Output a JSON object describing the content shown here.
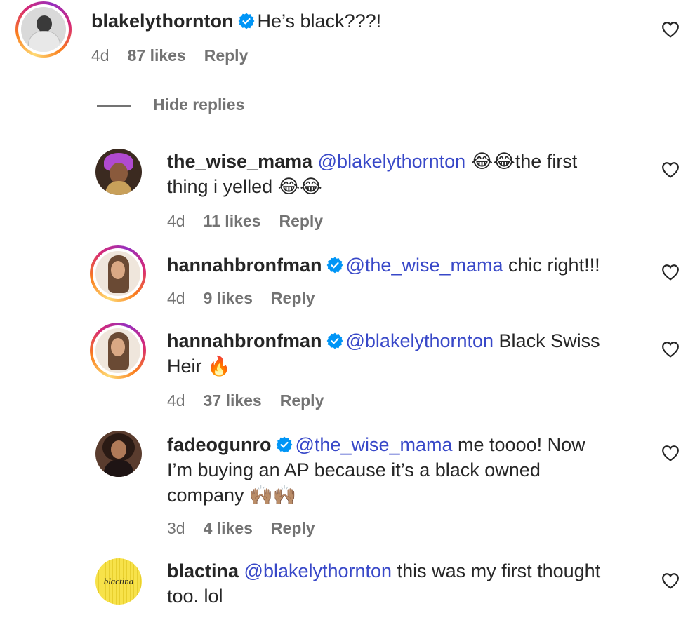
{
  "comments": [
    {
      "username": "blakelythornton",
      "verified": true,
      "text": "He’s black???!",
      "time": "4d",
      "likes": "87 likes",
      "reply": "Reply"
    },
    {
      "username": "the_wise_mama",
      "verified": false,
      "mention": "@blakelythornton",
      "text_a": "😂😂the first",
      "text_b": "thing i yelled 😂😂",
      "time": "4d",
      "likes": "11 likes",
      "reply": "Reply"
    },
    {
      "username": "hannahbronfman",
      "verified": true,
      "mention": "@the_wise_mama",
      "text": "chic right!!!",
      "time": "4d",
      "likes": "9 likes",
      "reply": "Reply"
    },
    {
      "username": "hannahbronfman",
      "verified": true,
      "mention": "@blakelythornton",
      "text_a": "Black Swiss",
      "text_b": "Heir 🔥",
      "time": "4d",
      "likes": "37 likes",
      "reply": "Reply"
    },
    {
      "username": "fadeogunro",
      "verified": true,
      "mention": "@the_wise_mama",
      "text_a": "me toooo! Now",
      "text_b": "I’m buying an AP because it’s a black owned",
      "text_c": "company 🙌🏽🙌🏽",
      "time": "3d",
      "likes": "4 likes",
      "reply": "Reply"
    },
    {
      "username": "blactina",
      "verified": false,
      "mention": "@blakelythornton",
      "text_a": "this was my first thought",
      "text_b": "too. lol",
      "avatar_text": "blactina"
    }
  ],
  "hide_replies": "Hide replies",
  "icons": {
    "verified": "verified-badge-icon",
    "heart": "heart-outline-icon"
  },
  "colors": {
    "mention": "#3848c8",
    "verified": "#0095f6",
    "muted": "#737373"
  }
}
